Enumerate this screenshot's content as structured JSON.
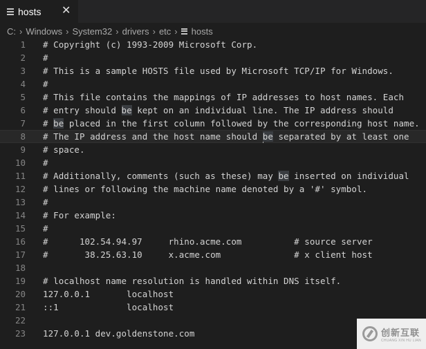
{
  "tab": {
    "label": "hosts",
    "close": "✕",
    "icon": "file-lines-icon"
  },
  "breadcrumb": {
    "items": [
      "C:",
      "Windows",
      "System32",
      "drivers",
      "etc",
      "hosts"
    ],
    "separator": "›"
  },
  "editor": {
    "current_line": 8,
    "lines": [
      {
        "n": "1",
        "text": "# Copyright (c) 1993-2009 Microsoft Corp."
      },
      {
        "n": "2",
        "text": "#"
      },
      {
        "n": "3",
        "text": "# This is a sample HOSTS file used by Microsoft TCP/IP for Windows."
      },
      {
        "n": "4",
        "text": "#"
      },
      {
        "n": "5",
        "text": "# This file contains the mappings of IP addresses to host names. Each"
      },
      {
        "n": "6",
        "pre": "# entry should ",
        "hl": "be",
        "post": " kept on an individual line. The IP address should"
      },
      {
        "n": "7",
        "pre": "# ",
        "hl": "be",
        "post": " placed in the first column followed by the corresponding host name."
      },
      {
        "n": "8",
        "pre": "# The IP address and the host name should ",
        "hl": "be",
        "post": " separated by at least one",
        "cursor": true
      },
      {
        "n": "9",
        "text": "# space."
      },
      {
        "n": "10",
        "text": "#"
      },
      {
        "n": "11",
        "pre": "# Additionally, comments (such as these) may ",
        "hl": "be",
        "post": " inserted on individual"
      },
      {
        "n": "12",
        "text": "# lines or following the machine name denoted by a '#' symbol."
      },
      {
        "n": "13",
        "text": "#"
      },
      {
        "n": "14",
        "text": "# For example:"
      },
      {
        "n": "15",
        "text": "#"
      },
      {
        "n": "16",
        "text": "#      102.54.94.97     rhino.acme.com          # source server"
      },
      {
        "n": "17",
        "text": "#       38.25.63.10     x.acme.com              # x client host"
      },
      {
        "n": "18",
        "text": ""
      },
      {
        "n": "19",
        "text": "# localhost name resolution is handled within DNS itself."
      },
      {
        "n": "20",
        "text": "127.0.0.1       localhost"
      },
      {
        "n": "21",
        "text": "::1             localhost"
      },
      {
        "n": "22",
        "text": ""
      },
      {
        "n": "23",
        "text": "127.0.0.1 dev.goldenstone.com"
      }
    ]
  },
  "watermark": {
    "cn": "创新互联",
    "en": "CHUANG XIN HU LIAN"
  }
}
